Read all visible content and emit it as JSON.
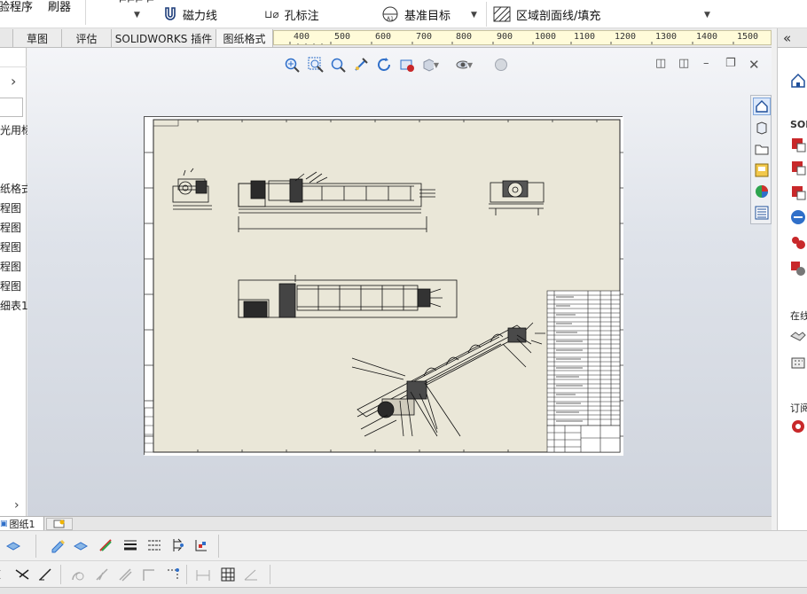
{
  "ribbon": {
    "partial_left_1": "验程序",
    "partial_left_2": "刷器",
    "magnetic_line": "磁力线",
    "hole_callout": "孔标注",
    "datum_target": "基准目标",
    "area_hatch": "区域剖面线/填充",
    "collapse_symbol": "«"
  },
  "tabs": [
    "草图",
    "评估",
    "SOLIDWORKS 插件",
    "图纸格式"
  ],
  "ruler": [
    "400",
    "500",
    "600",
    "700",
    "800",
    "900",
    "1000",
    "1100",
    "1200",
    "1300",
    "1400",
    "1500"
  ],
  "left_panel": {
    "expand_symbol": "›",
    "items": [
      "光用标",
      "纸格式",
      "程图",
      "程图",
      "程图",
      "程图",
      "程图",
      "细表1"
    ],
    "bottom_symbol": "›"
  },
  "sheet_tabs": {
    "active": "图纸1"
  },
  "right_panel": {
    "label_solid": "SOL",
    "label_zai": "在线",
    "label_ding": "订阅"
  },
  "colors": {
    "sheet_bg": "#eae7d8",
    "accent_blue": "#2f6fc9",
    "sw_red": "#c8282a"
  }
}
